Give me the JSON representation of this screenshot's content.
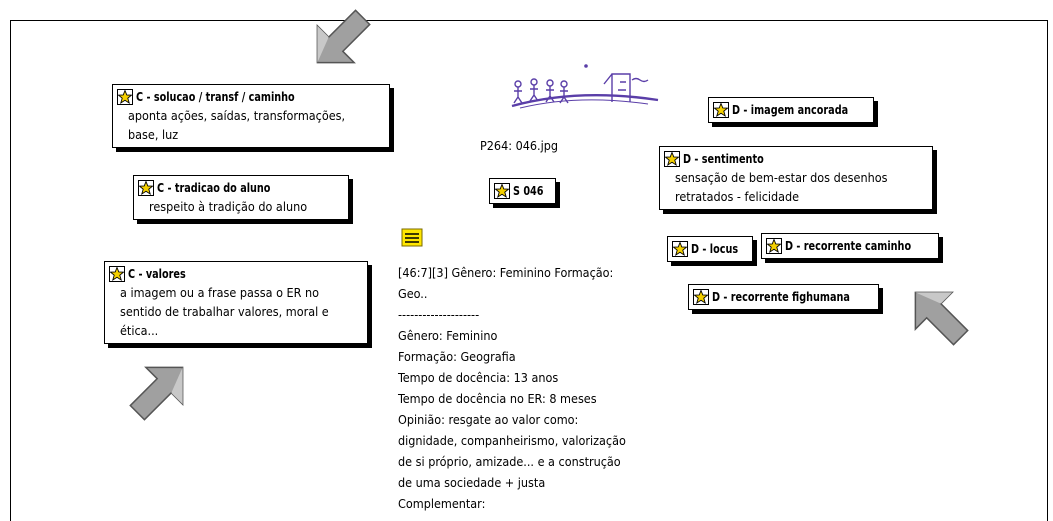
{
  "image_caption": "P264: 046.jpg",
  "code_nodes": [
    {
      "id": "solucao",
      "title": "C - solucao / transf / caminho",
      "body": [
        "aponta ações, saídas, transformações,",
        "base, luz"
      ]
    },
    {
      "id": "tradicao",
      "title": "C - tradicao do aluno",
      "body": [
        "respeito à tradição do aluno"
      ]
    },
    {
      "id": "valores",
      "title": "C - valores",
      "body": [
        "a imagem ou a frase passa o ER no",
        "sentido de trabalhar valores, moral e",
        "ética..."
      ]
    },
    {
      "id": "s046",
      "title": "S 046",
      "body": []
    },
    {
      "id": "imagem",
      "title": "D - imagem ancorada",
      "body": []
    },
    {
      "id": "sentimento",
      "title": "D - sentimento",
      "body": [
        "sensação de bem-estar dos desenhos",
        "retratados - felicidade"
      ]
    },
    {
      "id": "locus",
      "title": "D - locus",
      "body": []
    },
    {
      "id": "caminho",
      "title": "D - recorrente caminho",
      "body": []
    },
    {
      "id": "fighumana",
      "title": "D - recorrente fighumana",
      "body": []
    }
  ],
  "memo_lines": [
    "[46:7][3] Gênero: Feminino Formação:",
    "Geo..",
    "--------------------",
    "Gênero: Feminino",
    "Formação: Geografia",
    "Tempo de docência: 13 anos",
    "Tempo de docência no ER: 8 meses",
    "Opinião: resgate ao valor como:",
    "dignidade, companheirismo, valorização",
    "de  si próprio, amizade... e a construção",
    "de  uma sociedade + justa",
    "Complementar:"
  ],
  "colors": {
    "star_fill": "#f5d000",
    "arrow_fill": "#a0a0a0",
    "memo_icon": "#ffe600",
    "drawing_purple": "#5a3ea8"
  },
  "icons": [
    "code-star-icon",
    "memo-icon",
    "pointer-arrow-icon"
  ]
}
